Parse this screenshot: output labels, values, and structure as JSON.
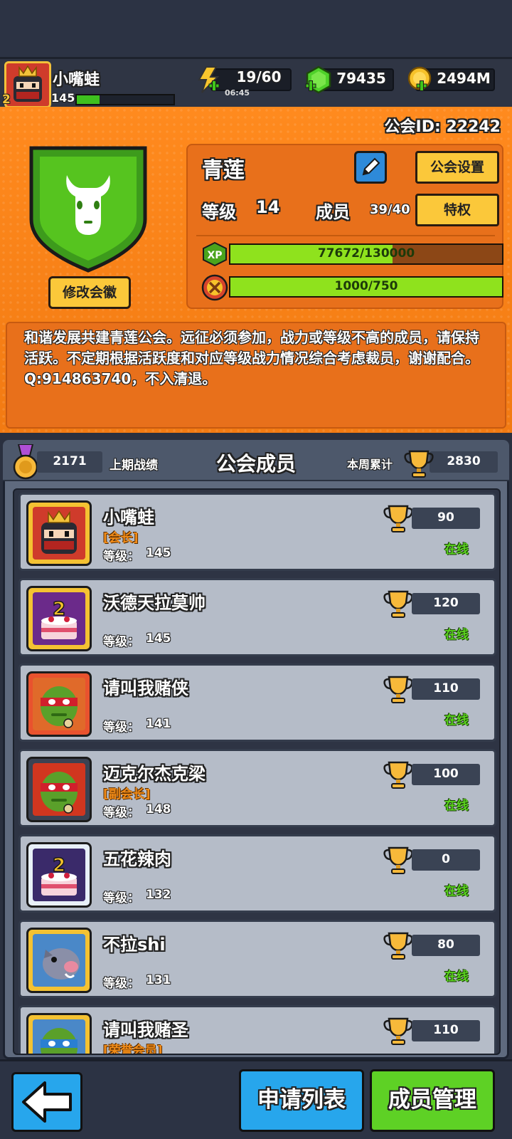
{
  "player": {
    "name": "小嘴蛙",
    "level": "145",
    "rank": "2"
  },
  "resources": {
    "energy": "19/60",
    "energy_timer": "06:45",
    "gems": "79435",
    "coins": "2494M"
  },
  "guild": {
    "id_text": "公会ID: 22242",
    "name": "青莲",
    "edit_emblem_label": "修改会徽",
    "settings_label": "公会设置",
    "level_label": "等级",
    "level_value": "14",
    "members_label": "成员",
    "members_value": "39/40",
    "privilege_label": "特权",
    "xp_icon_text": "XP",
    "xp_text": "77672/130000",
    "xp_progress": 0.597,
    "contribution_text": "1000/750",
    "contribution_progress": 1.0,
    "announcement": "和谐发展共建青莲公会。远征必须参加，战力或等级不高的成员，请保持活跃。不定期根据活跃度和对应等级战力情况综合考虑裁员，谢谢配合。Q:914863740，不入清退。"
  },
  "members_panel": {
    "title": "公会成员",
    "last_score_value": "2171",
    "last_score_label": "上期战绩",
    "week_label": "本周累计",
    "week_score_value": "2830",
    "level_prefix": "等级：",
    "members": [
      {
        "name": "小嘴蛙",
        "role": "[会长]",
        "level": "145",
        "score": "90",
        "status": "在线",
        "avatar": "ninja"
      },
      {
        "name": "沃德天拉莫帅",
        "role": "",
        "level": "145",
        "score": "120",
        "status": "在线",
        "avatar": "cake"
      },
      {
        "name": "请叫我赌侠",
        "role": "",
        "level": "141",
        "score": "110",
        "status": "在线",
        "avatar": "turtle-red"
      },
      {
        "name": "迈克尔杰克梁",
        "role": "[副会长]",
        "level": "148",
        "score": "100",
        "status": "在线",
        "avatar": "turtle-red"
      },
      {
        "name": "五花辣肉",
        "role": "",
        "level": "132",
        "score": "0",
        "status": "在线",
        "avatar": "cake"
      },
      {
        "name": "不拉shi",
        "role": "",
        "level": "131",
        "score": "80",
        "status": "在线",
        "avatar": "boar"
      },
      {
        "name": "请叫我赌圣",
        "role": "[荣誉会员]",
        "level": "",
        "score": "110",
        "status": "",
        "avatar": "turtle-blue"
      }
    ]
  },
  "bottom": {
    "apply_list_label": "申请列表",
    "member_manage_label": "成员管理"
  },
  "colors": {
    "orange_bg": "#f27a12",
    "yellow_button": "#fbc83a",
    "blue_button": "#27a6ec",
    "green_button": "#5ed125",
    "online_green": "#5ad21f",
    "bar_green": "#8fe21d"
  }
}
